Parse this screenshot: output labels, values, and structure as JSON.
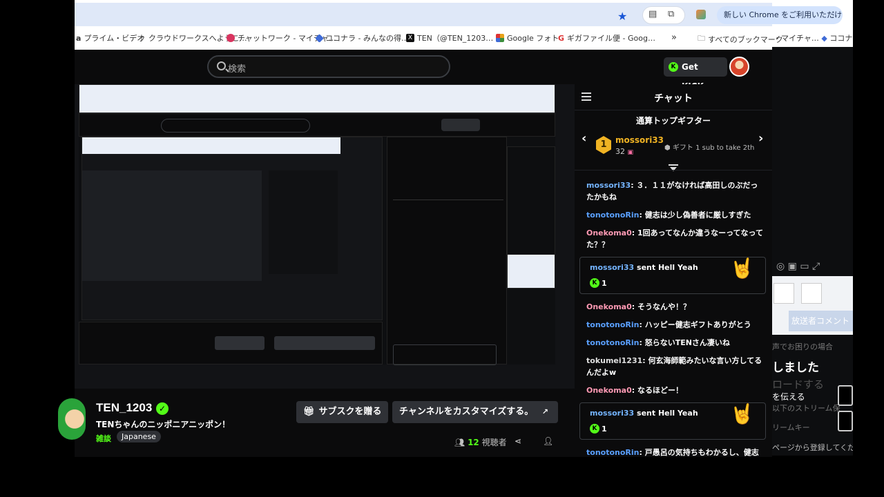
{
  "browser": {
    "promo_label": "新しい Chrome をご利用いただけます",
    "bookmarks": [
      {
        "label": "プライム・ビデオ",
        "color": "#222"
      },
      {
        "label": "クラウドワークスへようこ…",
        "color": "#333"
      },
      {
        "label": "チャットワーク - マイチャ…",
        "color": "#d9345f"
      },
      {
        "label": "ココナラ - みんなの得…",
        "color": "#3f6bd6"
      },
      {
        "label": "TEN（@TEN_1203…",
        "color": "#111"
      },
      {
        "label": "Google フォト",
        "color": "#e8a21a"
      },
      {
        "label": "ギガファイル便 - Goog…",
        "color": "#d33"
      }
    ],
    "more_label": "»",
    "all_bookmarks_label": "すべてのブックマーク"
  },
  "site": {
    "search_placeholder": "検索",
    "get_kicks_label": "Get KICKs"
  },
  "stream": {
    "channel_name": "TEN_1203",
    "title": "TENちゃんのニッポニアニッポン！",
    "category": "雑談",
    "language": "Japanese",
    "gift_sub_label": "サブスクを贈る",
    "customize_label": "チャンネルをカスタマイズする。",
    "viewer_count": "12",
    "viewer_label": "視聴者"
  },
  "chat": {
    "title": "チャット",
    "top_gifter_title": "通算トップギフター",
    "top_gifter": {
      "rank": "1",
      "name": "mossori33",
      "count": "32",
      "next": "ギフト 1 sub to take 2th"
    },
    "messages": [
      {
        "user": "mossori33",
        "text": "３．１１がなければ高田しのぶだったかもね",
        "style": "blue2"
      },
      {
        "user": "tonotonoRin",
        "text": "健志は少し偽善者に厳しすぎた",
        "style": "uname"
      },
      {
        "user": "Onekoma0",
        "text": "1回あってなんか違うなーってなってた？？",
        "style": "pink"
      },
      {
        "gift": true,
        "user": "mossori33",
        "action": "sent Hell Yeah",
        "amount": "1"
      },
      {
        "user": "Onekoma0",
        "text": "そうなんや！？",
        "style": "pink"
      },
      {
        "user": "tonotonoRin",
        "text": "ハッピー健志ギフトありがとう",
        "style": "uname"
      },
      {
        "user": "tonotonoRin",
        "text": "怒らないTENさん凄いね",
        "style": "uname"
      },
      {
        "user": "tokumei1231",
        "text": "何玄海師範みたいな言い方してるんだよw",
        "style": "white"
      },
      {
        "user": "Onekoma0",
        "text": "なるほどー！",
        "style": "pink"
      },
      {
        "gift": true,
        "user": "mossori33",
        "action": "sent Hell Yeah",
        "amount": "1"
      },
      {
        "user": "tonotonoRin",
        "text": "戸愚呂の気持ちもわかるし、健志の",
        "style": "uname"
      }
    ]
  },
  "strip": {
    "bookmark_fragment": "・マイチャ…",
    "bookmark_fragment2": "ココナラ - みん",
    "comment_label": "放送者コメント",
    "lines": [
      "声でお困りの場合",
      "しました",
      "ロードする",
      "を伝える",
      "以下のストリーム保",
      "リームキー",
      "ページから登録してくだ"
    ]
  },
  "colors": {
    "accent": "#53fc18",
    "gifter": "#f0b323"
  }
}
